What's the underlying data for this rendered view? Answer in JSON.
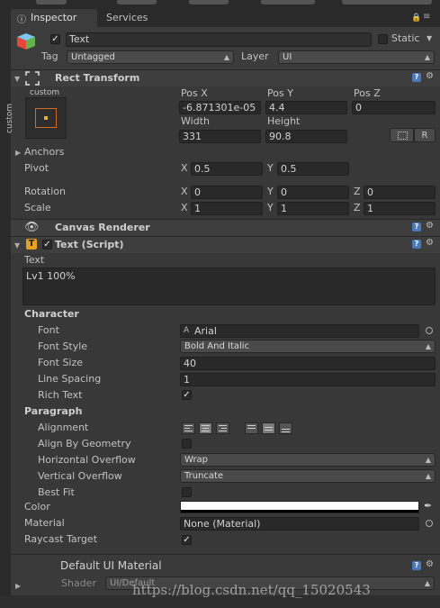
{
  "tabs": [
    {
      "label": "Inspector"
    },
    {
      "label": "Services"
    }
  ],
  "header": {
    "object_name": "Text",
    "static_label": "Static",
    "tag_label": "Tag",
    "tag_value": "Untagged",
    "layer_label": "Layer",
    "layer_value": "UI"
  },
  "rect_transform": {
    "title": "Rect Transform",
    "anchor_preset_top": "custom",
    "anchor_preset_side": "custom",
    "pos_x_label": "Pos X",
    "pos_y_label": "Pos Y",
    "pos_z_label": "Pos Z",
    "pos_x": "-6.871301e-05",
    "pos_y": "4.4",
    "pos_z": "0",
    "width_label": "Width",
    "height_label": "Height",
    "width": "331",
    "height": "90.8",
    "r_button": "R",
    "anchors_label": "Anchors",
    "pivot_label": "Pivot",
    "pivot_x": "0.5",
    "pivot_y": "0.5",
    "rotation_label": "Rotation",
    "rot_x": "0",
    "rot_y": "0",
    "rot_z": "0",
    "scale_label": "Scale",
    "scale_x": "1",
    "scale_y": "1",
    "scale_z": "1",
    "x": "X",
    "y": "Y",
    "z": "Z"
  },
  "canvas_renderer": {
    "title": "Canvas Renderer"
  },
  "text_script": {
    "title": "Text (Script)",
    "text_label": "Text",
    "text_value": "Lv1  100%",
    "character_label": "Character",
    "font_label": "Font",
    "font_value": "Arial",
    "font_style_label": "Font Style",
    "font_style_value": "Bold And Italic",
    "font_size_label": "Font Size",
    "font_size_value": "40",
    "line_spacing_label": "Line Spacing",
    "line_spacing_value": "1",
    "rich_text_label": "Rich Text",
    "paragraph_label": "Paragraph",
    "alignment_label": "Alignment",
    "align_by_geometry_label": "Align By Geometry",
    "horizontal_overflow_label": "Horizontal Overflow",
    "horizontal_overflow_value": "Wrap",
    "vertical_overflow_label": "Vertical Overflow",
    "vertical_overflow_value": "Truncate",
    "best_fit_label": "Best Fit",
    "color_label": "Color",
    "material_label": "Material",
    "material_value": "None (Material)",
    "raycast_target_label": "Raycast Target"
  },
  "material_section": {
    "title": "Default UI Material",
    "shader_label": "Shader",
    "shader_value": "UI/Default"
  },
  "watermark": "https://blog.csdn.net/qq_15020543",
  "colors": {
    "text_color": "#ffffff",
    "accent_help": "#4a79b8",
    "script_icon": "#e8a020"
  }
}
